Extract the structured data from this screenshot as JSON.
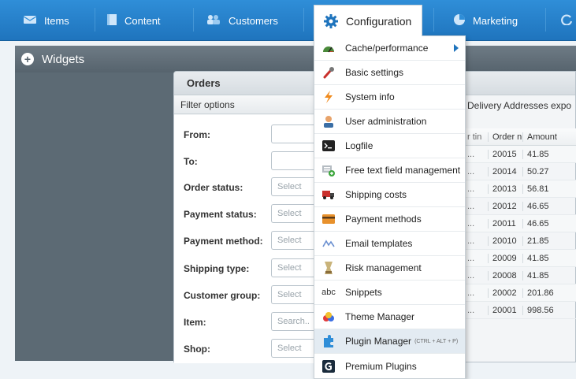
{
  "nav": {
    "items": [
      "Items",
      "Content",
      "Customers",
      "Configuration",
      "Marketing"
    ]
  },
  "widgets": {
    "title": "Widgets"
  },
  "orders": {
    "title": "Orders",
    "filter_title": "Filter options",
    "filters": [
      {
        "label": "From:",
        "placeholder": ""
      },
      {
        "label": "To:",
        "placeholder": ""
      },
      {
        "label": "Order status:",
        "placeholder": "Select"
      },
      {
        "label": "Payment status:",
        "placeholder": "Select"
      },
      {
        "label": "Payment method:",
        "placeholder": "Select"
      },
      {
        "label": "Shipping type:",
        "placeholder": "Select"
      },
      {
        "label": "Customer group:",
        "placeholder": "Select"
      },
      {
        "label": "Item:",
        "placeholder": "Search.."
      },
      {
        "label": "Shop:",
        "placeholder": "Select"
      }
    ],
    "tab_label": "Delivery Addresses expo",
    "columns": [
      "r tin",
      "Order nu",
      "Amount"
    ],
    "rows": [
      {
        "c1": "...",
        "order": "20015",
        "amount": "41.85"
      },
      {
        "c1": "...",
        "order": "20014",
        "amount": "50.27"
      },
      {
        "c1": "...",
        "order": "20013",
        "amount": "56.81"
      },
      {
        "c1": "...",
        "order": "20012",
        "amount": "46.65"
      },
      {
        "c1": "...",
        "order": "20011",
        "amount": "46.65"
      },
      {
        "c1": "...",
        "order": "20010",
        "amount": "21.85"
      },
      {
        "c1": "...",
        "order": "20009",
        "amount": "41.85"
      },
      {
        "c1": "...",
        "order": "20008",
        "amount": "41.85"
      },
      {
        "c1": "...",
        "order": "20002",
        "amount": "201.86"
      },
      {
        "c1": "...",
        "order": "20001",
        "amount": "998.56"
      }
    ]
  },
  "menu": {
    "items": [
      {
        "label": "Cache/performance",
        "icon": "speedometer-icon",
        "submenu": true
      },
      {
        "label": "Basic settings",
        "icon": "wrench-icon"
      },
      {
        "label": "System info",
        "icon": "lightning-icon"
      },
      {
        "label": "User administration",
        "icon": "user-icon"
      },
      {
        "label": "Logfile",
        "icon": "terminal-icon"
      },
      {
        "label": "Free text field management",
        "icon": "text-field-icon"
      },
      {
        "label": "Shipping costs",
        "icon": "truck-icon"
      },
      {
        "label": "Payment methods",
        "icon": "credit-card-icon"
      },
      {
        "label": "Email templates",
        "icon": "email-template-icon"
      },
      {
        "label": "Risk management",
        "icon": "risk-icon"
      },
      {
        "label": "Snippets",
        "icon": "abc-icon"
      },
      {
        "label": "Theme Manager",
        "icon": "theme-icon"
      },
      {
        "label": "Plugin Manager",
        "icon": "puzzle-icon",
        "shortcut": "(CTRL + ALT + P)"
      },
      {
        "label": "Premium Plugins",
        "icon": "premium-icon"
      }
    ]
  }
}
